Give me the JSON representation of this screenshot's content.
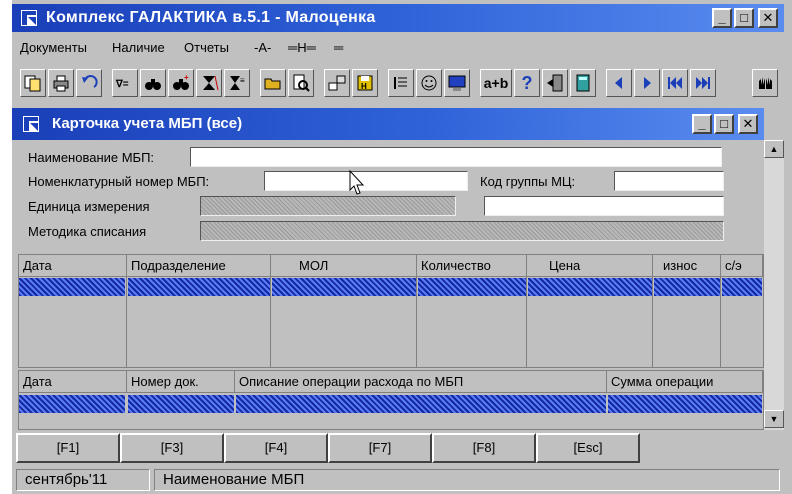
{
  "app": {
    "title": "Комплекс ГАЛАКТИКА в.5.1 - Малоценка",
    "min_label": "_",
    "max_label": "□",
    "close_label": "✕"
  },
  "menu": [
    "Документы",
    "Наличие",
    "Отчеты",
    "-А-",
    "═Н═",
    "═"
  ],
  "toolbar": {
    "icons": [
      "copy-doc-icon",
      "print-icon",
      "undo-icon",
      "filter-icon",
      "binoculars-icon",
      "binoculars-plus-icon",
      "sort-icon",
      "sort-alt-icon",
      "open-folder-icon",
      "find-doc-icon",
      "network-icon",
      "save-disk-icon",
      "list-icon",
      "smiley-icon",
      "monitor-icon",
      "text-ab-icon",
      "help-icon",
      "exit-door-icon",
      "calculator-icon",
      "prev-icon",
      "next-icon",
      "first-icon",
      "last-icon",
      "hands-icon"
    ],
    "text_ab": "a+b",
    "help": "?"
  },
  "child": {
    "title": "Карточка учета МБП (все)",
    "min_label": "_",
    "max_label": "□",
    "close_label": "✕"
  },
  "form": {
    "name_label": "Наименование МБП:",
    "name_value": "",
    "nomenclature_label": "Номенклатурный номер МБП:",
    "nomenclature_value": "",
    "group_label": "Код группы МЦ:",
    "group_value": "",
    "unit_label": "Единица измерения",
    "unit_extra_value": "",
    "method_label": "Методика списания"
  },
  "grid1": {
    "columns": [
      "Дата",
      "Подразделение",
      "МОЛ",
      "Количество",
      "Цена",
      "износ",
      "с/э"
    ]
  },
  "grid2": {
    "columns": [
      "Дата",
      "Номер док.",
      "Описание операции расхода по МБП",
      "Сумма операции"
    ]
  },
  "fkeys": [
    "[F1]",
    "[F3]",
    "[F4]",
    "[F7]",
    "[F8]",
    "[Esc]"
  ],
  "status": {
    "period": "сентябрь'11",
    "field": "Наименование МБП"
  }
}
